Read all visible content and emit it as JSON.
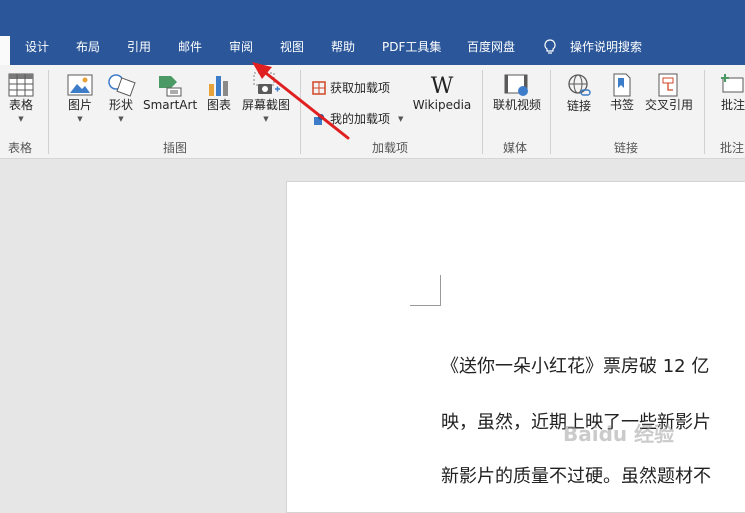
{
  "tabs": [
    "设计",
    "布局",
    "引用",
    "邮件",
    "审阅",
    "视图",
    "帮助",
    "PDF工具集",
    "百度网盘"
  ],
  "tell_me": "操作说明搜索",
  "ribbon": {
    "tables": {
      "label": "表格",
      "group": "表格"
    },
    "illustrations": {
      "pictures": "图片",
      "shapes": "形状",
      "smartart": "SmartArt",
      "chart": "图表",
      "screenshot": "屏幕截图",
      "group": "插图"
    },
    "addins": {
      "get_addins": "获取加载项",
      "my_addins": "我的加载项",
      "wikipedia": "Wikipedia",
      "group": "加载项"
    },
    "media": {
      "online_video": "联机视频",
      "group": "媒体"
    },
    "links": {
      "link": "链接",
      "bookmark": "书签",
      "cross_ref": "交叉引用",
      "group": "链接"
    },
    "comments": {
      "comment": "批注",
      "group": "批注"
    }
  },
  "document": {
    "lines": [
      "《送你一朵小红花》票房破 12 亿",
      "映，虽然，近期上映了一些新影片",
      "新影片的质量不过硬。虽然题材不"
    ]
  },
  "watermark": "Baidu 经验",
  "colors": {
    "tabbar": "#2b579a",
    "arrow": "#e02020"
  }
}
